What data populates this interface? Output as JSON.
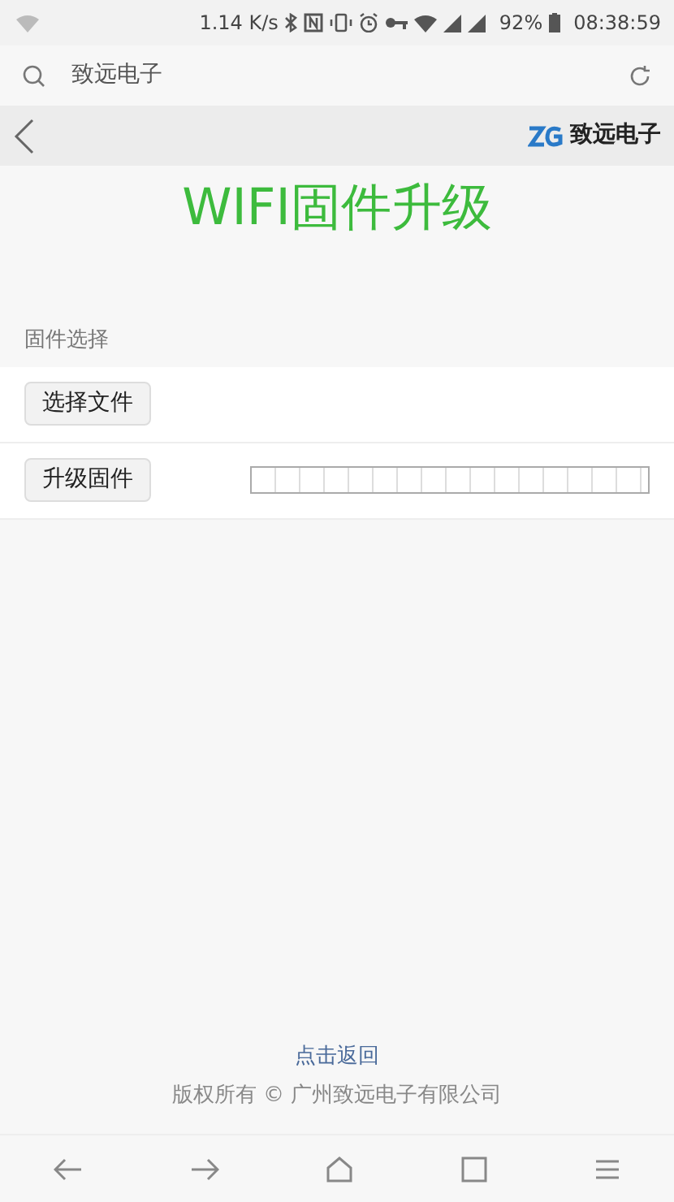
{
  "status_bar": {
    "speed": "1.14 K/s",
    "battery": "92%",
    "time": "08:38:59"
  },
  "address_bar": {
    "text": "致远电子"
  },
  "header": {
    "brand": "致远电子"
  },
  "title": "WIFI固件升级",
  "section": {
    "label": "固件选择",
    "rows": [
      {
        "kind": "file",
        "button": "选择文件"
      },
      {
        "kind": "upgrade",
        "button": "升级固件",
        "level": 0
      }
    ]
  },
  "footer": {
    "link": "点击返回",
    "copyright": "版权所有 © 广州致远电子有限公司"
  }
}
